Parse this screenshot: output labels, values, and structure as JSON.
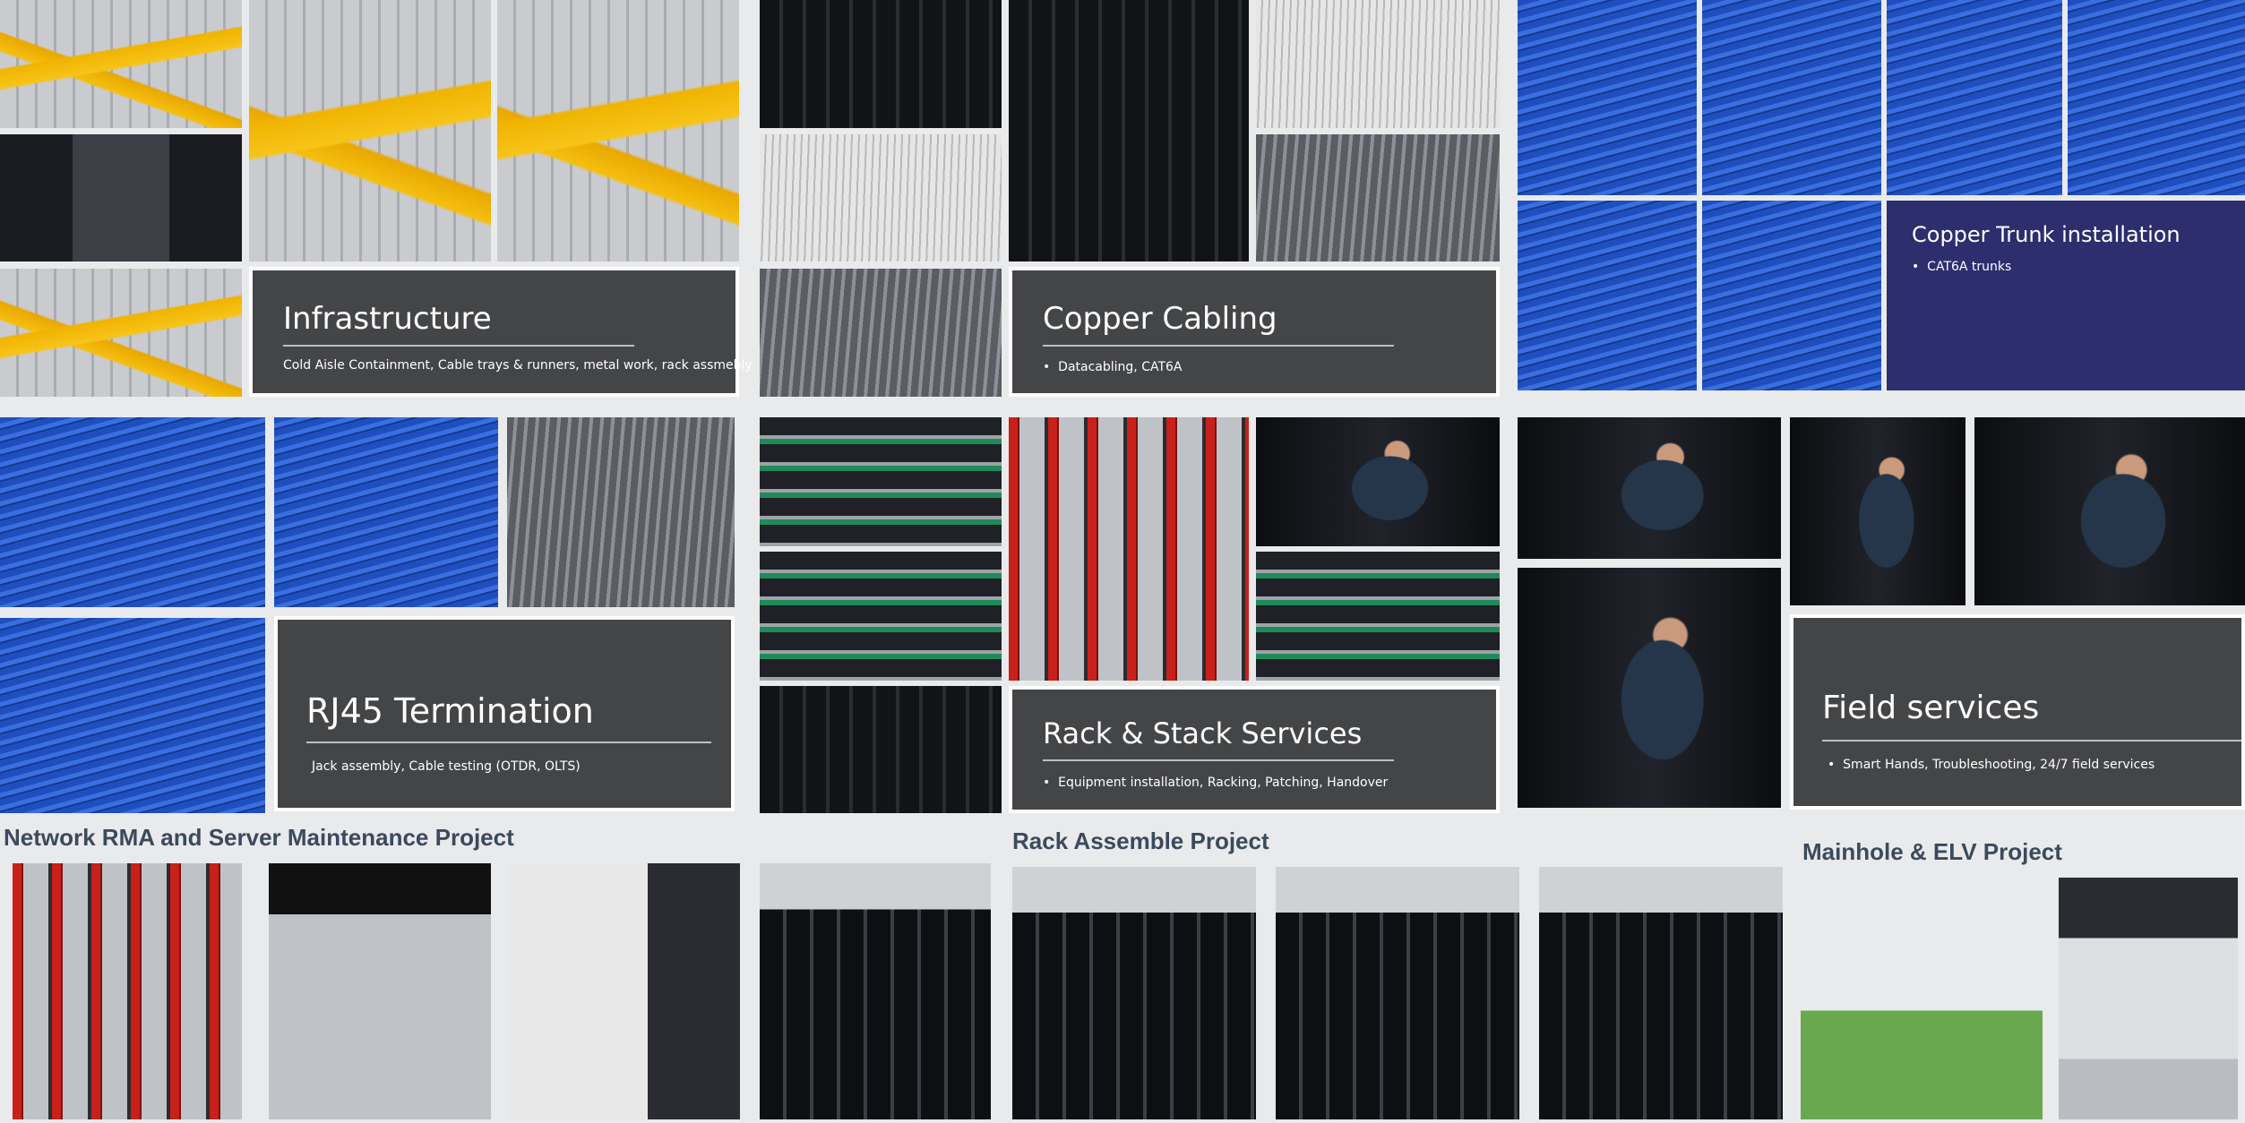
{
  "colors": {
    "panel_bg": "#444547",
    "trunk_panel_bg": "#2c2e6e",
    "project_title": "#3b4a5c"
  },
  "panels": {
    "infrastructure": {
      "title": "Infrastructure",
      "subtitle": "Cold Aisle Containment, Cable trays & runners, metal work, rack assmebly"
    },
    "copper": {
      "title": "Copper Cabling",
      "bullet": "Datacabling, CAT6A"
    },
    "trunk": {
      "title": "Copper Trunk installation",
      "bullet": "CAT6A trunks"
    },
    "rj45": {
      "title": "RJ45 Termination",
      "subtitle": "Jack assembly, Cable testing (OTDR, OLTS)"
    },
    "rackstack": {
      "title": "Rack & Stack Services",
      "bullet": "Equipment installation, Racking, Patching, Handover"
    },
    "field": {
      "title": "Field services",
      "bullet": "Smart Hands, Troubleshooting, 24/7 field services"
    }
  },
  "projects": {
    "rma": "Network RMA and Server Maintenance Project",
    "rack": "Rack Assemble Project",
    "manhole": "Mainhole & ELV Project"
  },
  "bullet_char": "•"
}
